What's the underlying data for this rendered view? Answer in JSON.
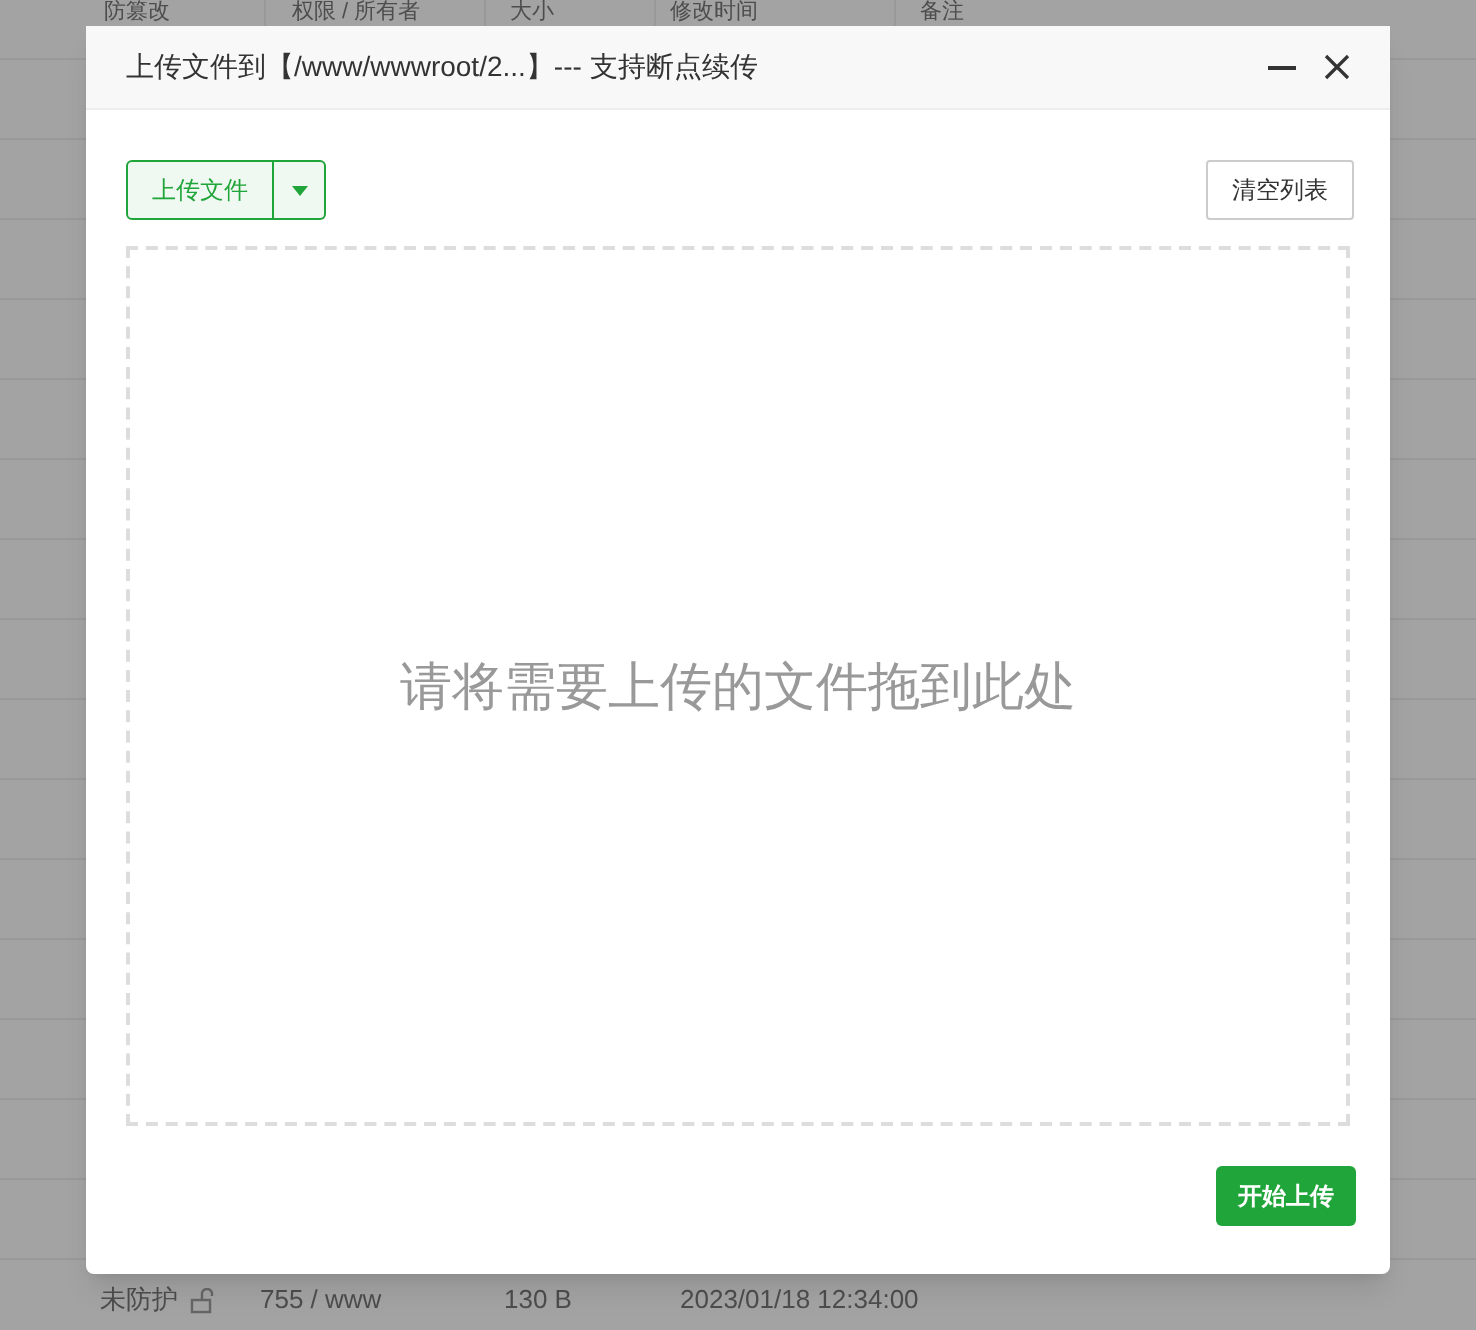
{
  "background_table": {
    "columns": [
      "防篡改",
      "权限 / 所有者",
      "大小",
      "修改时间",
      "备注"
    ],
    "rows": [
      {
        "protection": "未防护",
        "locked": false,
        "permission": "755 / www",
        "size": "130 B",
        "modified": "2023/01/18 12:34:00"
      }
    ]
  },
  "dialog": {
    "title": "上传文件到【/www/wwwroot/2...】--- 支持断点续传",
    "upload_button": "上传文件",
    "clear_button": "清空列表",
    "drop_hint": "请将需要上传的文件拖到此处",
    "start_button": "开始上传"
  }
}
